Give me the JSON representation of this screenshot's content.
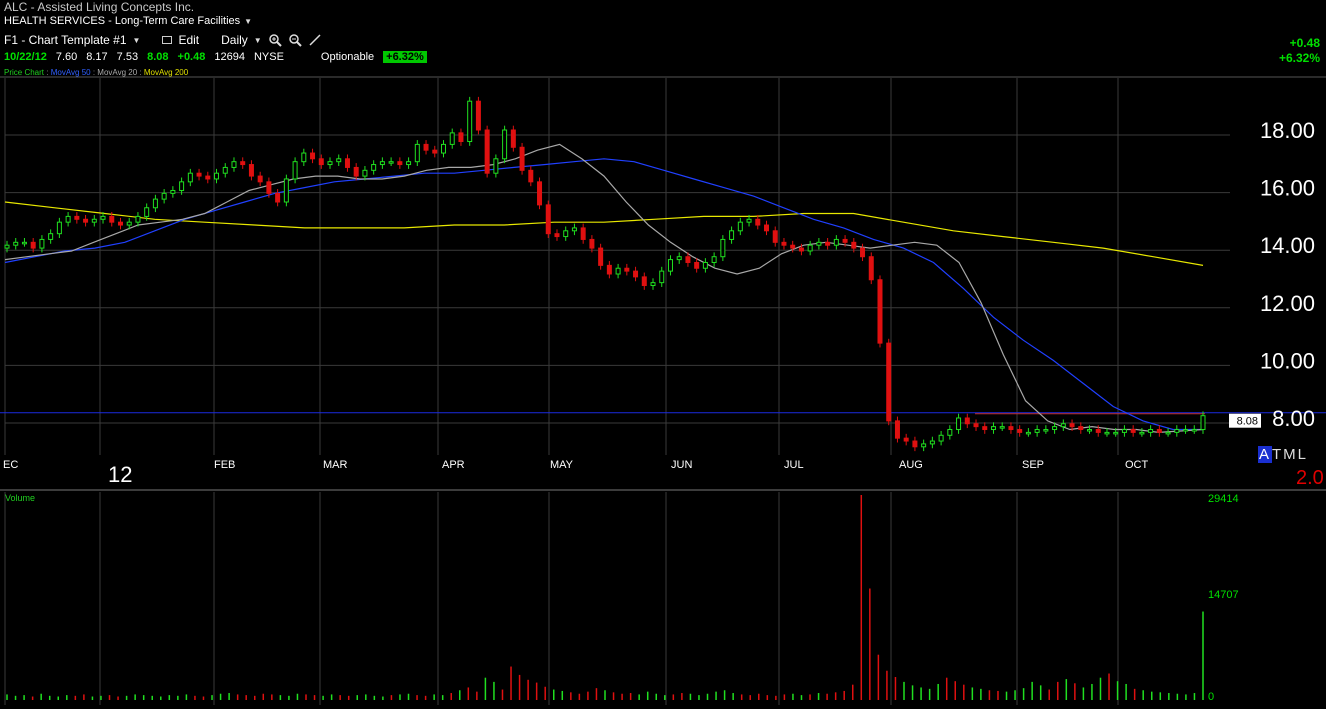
{
  "header": {
    "title": "ALC - Assisted Living Concepts Inc.",
    "sector": "HEALTH SERVICES - Long-Term Care Facilities",
    "toolbar": {
      "template": "F1 - Chart Template #1",
      "edit": "Edit",
      "period": "Daily"
    },
    "quote": {
      "date": "10/22/12",
      "open": "7.60",
      "high": "8.17",
      "low": "7.53",
      "last": "8.08",
      "change": "+0.48",
      "volume": "12694",
      "exchange": "NYSE",
      "optionable": "Optionable",
      "pct": "+6.32%"
    },
    "right_change": "+0.48",
    "right_pct": "+6.32%"
  },
  "indicators": {
    "price_chart": "Price Chart",
    "ma50": "MovAvg 50",
    "ma20": "MovAvg 20",
    "ma200": "MovAvg 200",
    "sep": ":"
  },
  "overlay": {
    "year_label": "12",
    "altml": "TML",
    "altml_a": "A",
    "score": "2.0"
  },
  "volume_panel": {
    "label": "Volume"
  },
  "colors": {
    "background": "#000000",
    "up": "#20e020",
    "down": "#e01010",
    "ma20": "#a8a8a8",
    "ma50": "#2040ff",
    "ma200": "#e8e800",
    "grid": "#3a3a3a",
    "last_line": "#1a2ae0",
    "text_green": "#00e000"
  },
  "chart_data": [
    {
      "type": "candlestick",
      "title": "",
      "x_labels": [
        "EC",
        "FEB",
        "MAR",
        "APR",
        "MAY",
        "JUN",
        "JUL",
        "AUG",
        "SEP",
        "OCT"
      ],
      "y_ticks": [
        "18.00",
        "16.00",
        "14.00",
        "12.00",
        "10.00",
        "8.00"
      ],
      "y_tick_values": [
        18,
        16,
        14,
        12,
        10,
        8
      ],
      "ylim": [
        6.8,
        20.1
      ],
      "last_price_label": "8.08",
      "last_price": 8.08,
      "close_prices": [
        14.0,
        14.1,
        14.1,
        13.9,
        14.2,
        14.4,
        14.8,
        15.0,
        14.9,
        14.8,
        14.9,
        15.0,
        14.8,
        14.7,
        14.8,
        15.0,
        15.3,
        15.6,
        15.8,
        15.9,
        16.2,
        16.5,
        16.4,
        16.3,
        16.5,
        16.7,
        16.9,
        16.8,
        16.4,
        16.2,
        15.8,
        15.5,
        16.3,
        16.9,
        17.2,
        17.0,
        16.8,
        16.9,
        17.0,
        16.7,
        16.4,
        16.6,
        16.8,
        16.9,
        16.9,
        16.8,
        16.9,
        17.5,
        17.3,
        17.2,
        17.5,
        17.9,
        17.6,
        19.0,
        18.0,
        16.5,
        17.0,
        18.0,
        17.4,
        16.6,
        16.2,
        15.4,
        14.4,
        14.3,
        14.5,
        14.6,
        14.2,
        13.9,
        13.3,
        13.0,
        13.2,
        13.1,
        12.9,
        12.6,
        12.7,
        13.1,
        13.5,
        13.6,
        13.4,
        13.2,
        13.4,
        13.6,
        14.2,
        14.5,
        14.8,
        14.9,
        14.7,
        14.5,
        14.1,
        14.0,
        13.9,
        13.8,
        14.0,
        14.1,
        14.0,
        14.2,
        14.1,
        13.9,
        13.6,
        12.8,
        10.6,
        7.9,
        7.3,
        7.2,
        7.0,
        7.1,
        7.2,
        7.4,
        7.6,
        8.0,
        7.8,
        7.7,
        7.6,
        7.7,
        7.7,
        7.6,
        7.5,
        7.5,
        7.6,
        7.6,
        7.7,
        7.8,
        7.7,
        7.6,
        7.6,
        7.5,
        7.5,
        7.5,
        7.6,
        7.5,
        7.5,
        7.6,
        7.5,
        7.5,
        7.6,
        7.6,
        7.6,
        8.08
      ],
      "ma20": [
        13.5,
        13.6,
        13.7,
        13.8,
        14.1,
        14.4,
        14.7,
        14.8,
        14.9,
        15.1,
        15.5,
        15.9,
        16.1,
        16.3,
        16.4,
        16.4,
        16.3,
        16.3,
        16.4,
        16.6,
        16.7,
        16.7,
        16.8,
        17.0,
        17.3,
        17.5,
        17.0,
        16.4,
        15.5,
        14.7,
        14.1,
        13.6,
        13.2,
        13.0,
        13.2,
        13.7,
        14.0,
        14.1,
        14.0,
        13.9,
        14.0,
        14.1,
        14.0,
        13.4,
        12.0,
        10.2,
        8.6,
        7.9,
        7.6,
        7.7,
        7.6,
        7.6,
        7.5,
        7.55,
        7.6
      ],
      "ma50": [
        13.4,
        13.6,
        13.8,
        13.9,
        14.1,
        14.5,
        14.9,
        15.2,
        15.5,
        15.8,
        16.0,
        16.2,
        16.3,
        16.4,
        16.5,
        16.5,
        16.6,
        16.7,
        16.8,
        16.9,
        17.0,
        16.9,
        16.6,
        16.3,
        16.0,
        15.7,
        15.3,
        14.9,
        14.6,
        14.2,
        13.9,
        13.4,
        12.5,
        11.5,
        10.7,
        10.0,
        9.2,
        8.4,
        7.9,
        7.6,
        7.6
      ],
      "ma200": [
        15.5,
        15.3,
        15.1,
        14.9,
        14.8,
        14.7,
        14.6,
        14.6,
        14.6,
        14.7,
        14.7,
        14.8,
        14.8,
        14.9,
        15.0,
        15.0,
        15.1,
        15.1,
        14.8,
        14.5,
        14.3,
        14.1,
        13.9,
        13.6,
        13.3
      ]
    },
    {
      "type": "bar",
      "title": "Volume",
      "y_ticks": [
        "29414",
        "14707",
        "0"
      ],
      "ylim": [
        0,
        29414
      ],
      "values": [
        800,
        600,
        700,
        500,
        900,
        600,
        500,
        700,
        600,
        800,
        500,
        600,
        700,
        500,
        600,
        800,
        700,
        600,
        500,
        700,
        600,
        800,
        600,
        500,
        700,
        900,
        1000,
        800,
        700,
        600,
        900,
        800,
        700,
        600,
        900,
        800,
        700,
        600,
        800,
        700,
        600,
        700,
        800,
        600,
        500,
        700,
        800,
        900,
        700,
        600,
        800,
        700,
        1000,
        1400,
        1800,
        1200,
        3200,
        2600,
        1500,
        4800,
        3600,
        2900,
        2500,
        1900,
        1500,
        1300,
        1100,
        900,
        1200,
        1700,
        1400,
        1100,
        900,
        1000,
        800,
        1200,
        900,
        700,
        800,
        1000,
        900,
        700,
        900,
        1200,
        1400,
        1000,
        800,
        700,
        900,
        700,
        600,
        800,
        900,
        700,
        800,
        1000,
        900,
        1100,
        1300,
        2200,
        29414,
        16000,
        6500,
        4200,
        3300,
        2600,
        2100,
        1800,
        1600,
        2300,
        3200,
        2700,
        2200,
        1800,
        1600,
        1400,
        1300,
        1200,
        1400,
        1700,
        2600,
        2100,
        1500,
        2600,
        3000,
        2400,
        1800,
        2300,
        3200,
        3800,
        2700,
        2300,
        1600,
        1400,
        1200,
        1100,
        1000,
        900,
        800,
        1000,
        12694
      ]
    }
  ]
}
